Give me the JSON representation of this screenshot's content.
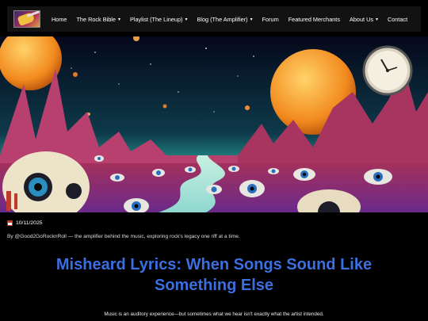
{
  "nav": {
    "items": [
      {
        "label": "Home",
        "dropdown": false
      },
      {
        "label": "The Rock Bible",
        "dropdown": true
      },
      {
        "label": "Playlist (The Lineup)",
        "dropdown": true
      },
      {
        "label": "Blog (The Amplifier)",
        "dropdown": true
      },
      {
        "label": "Forum",
        "dropdown": false
      },
      {
        "label": "Featured Merchants",
        "dropdown": false
      },
      {
        "label": "About Us",
        "dropdown": true
      },
      {
        "label": "Contact",
        "dropdown": false
      }
    ],
    "caret": "▾"
  },
  "post": {
    "date": "10/11/2025",
    "byline": "By @Good2GoRocknRoll — the amplifier behind the music, exploring rock's legacy one riff at a time.",
    "title": "Misheard Lyrics: When Songs Sound Like Something Else",
    "intro": "Music is an auditory experience—but sometimes what we hear isn't exactly what the artist intended."
  },
  "colors": {
    "accent": "#3b6fe0",
    "background": "#000000",
    "nav_bg": "#121212"
  },
  "icons": {
    "logo": "guitar-logo-icon",
    "date": "calendar-icon"
  }
}
